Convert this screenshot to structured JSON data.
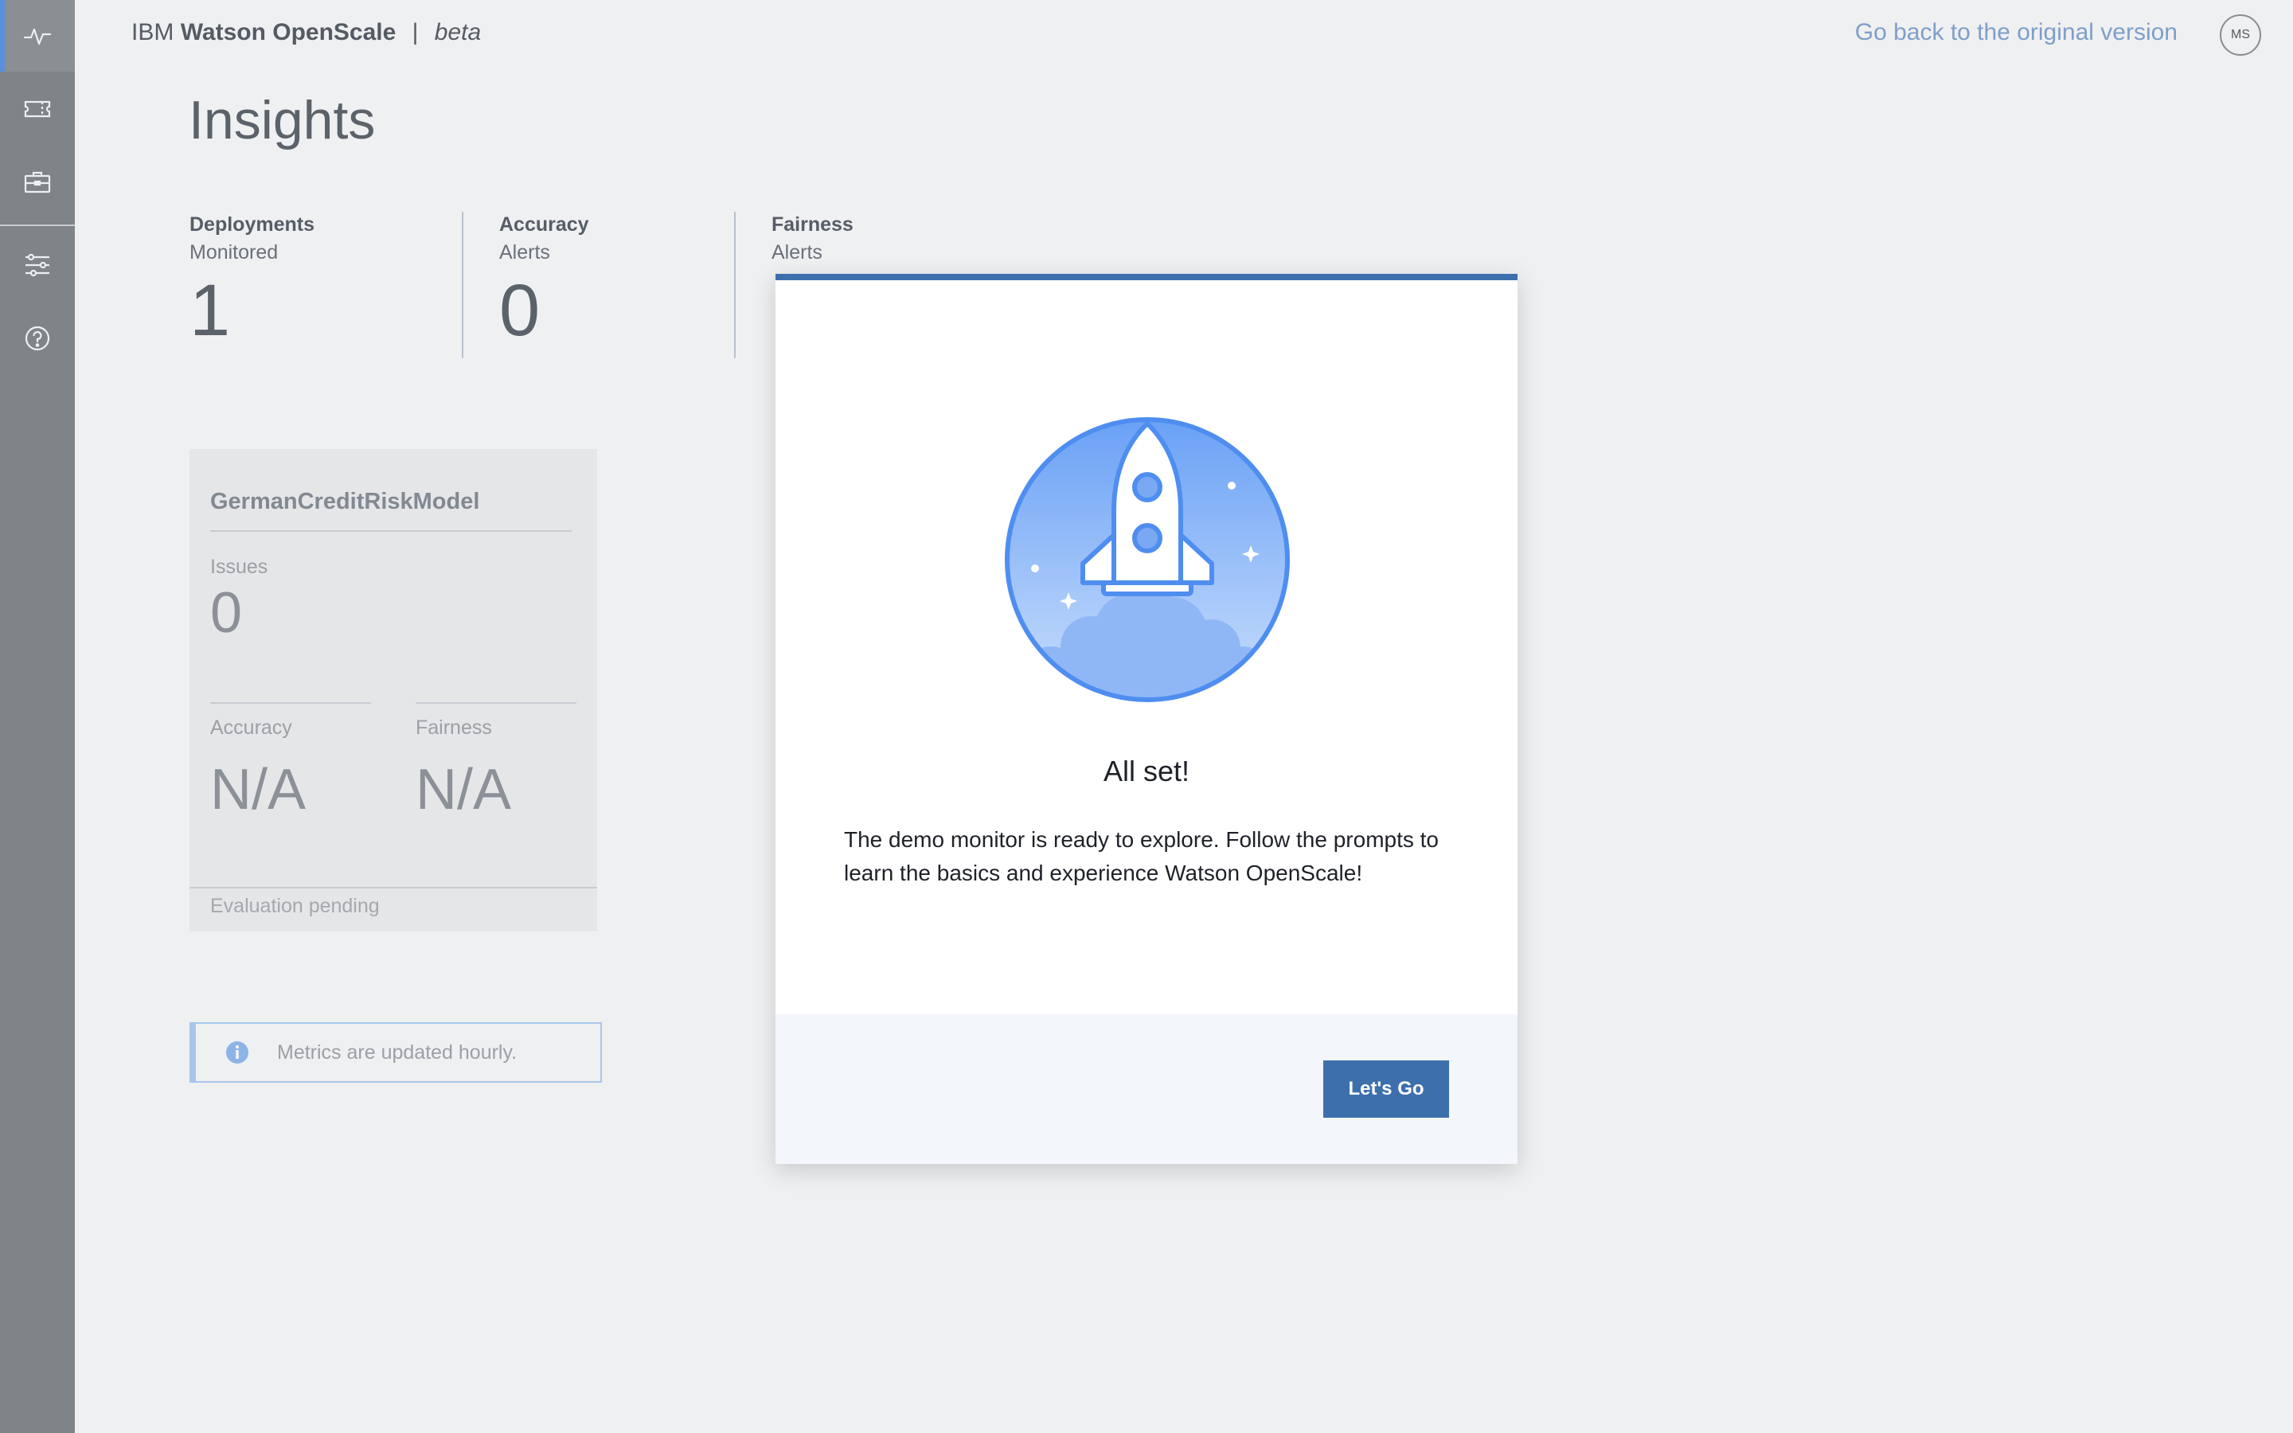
{
  "header": {
    "brand_prefix": "IBM",
    "brand_name": "Watson OpenScale",
    "brand_sep": "|",
    "brand_tag": "beta",
    "go_back": "Go back to the original version",
    "avatar_initials": "MS"
  },
  "sidebar": {
    "items": [
      {
        "icon": "activity-icon",
        "active": true
      },
      {
        "icon": "ticket-icon"
      },
      {
        "icon": "briefcase-icon"
      },
      {
        "icon": "sliders-icon"
      },
      {
        "icon": "help-icon"
      }
    ]
  },
  "page": {
    "title": "Insights"
  },
  "stats": [
    {
      "label": "Deployments",
      "sub": "Monitored",
      "value": "1"
    },
    {
      "label": "Accuracy",
      "sub": "Alerts",
      "value": "0"
    },
    {
      "label": "Fairness",
      "sub": "Alerts",
      "value": ""
    }
  ],
  "model_tile": {
    "name": "GermanCreditRiskModel",
    "issues_label": "Issues",
    "issues_value": "0",
    "accuracy_label": "Accuracy",
    "accuracy_value": "N/A",
    "fairness_label": "Fairness",
    "fairness_value": "N/A",
    "status": "Evaluation pending"
  },
  "notification": {
    "icon": "info-icon",
    "text": "Metrics are updated hourly."
  },
  "modal": {
    "illustration": "rocket-launch-illustration",
    "heading": "All set!",
    "body": "The demo monitor is ready to explore. Follow the prompts to learn the basics and experience Watson OpenScale!",
    "primary_button": "Let's Go"
  },
  "colors": {
    "accent": "#3d6fad",
    "link": "#7f9ec9",
    "sidebar": "#7f8488",
    "background": "#eff0f2"
  }
}
